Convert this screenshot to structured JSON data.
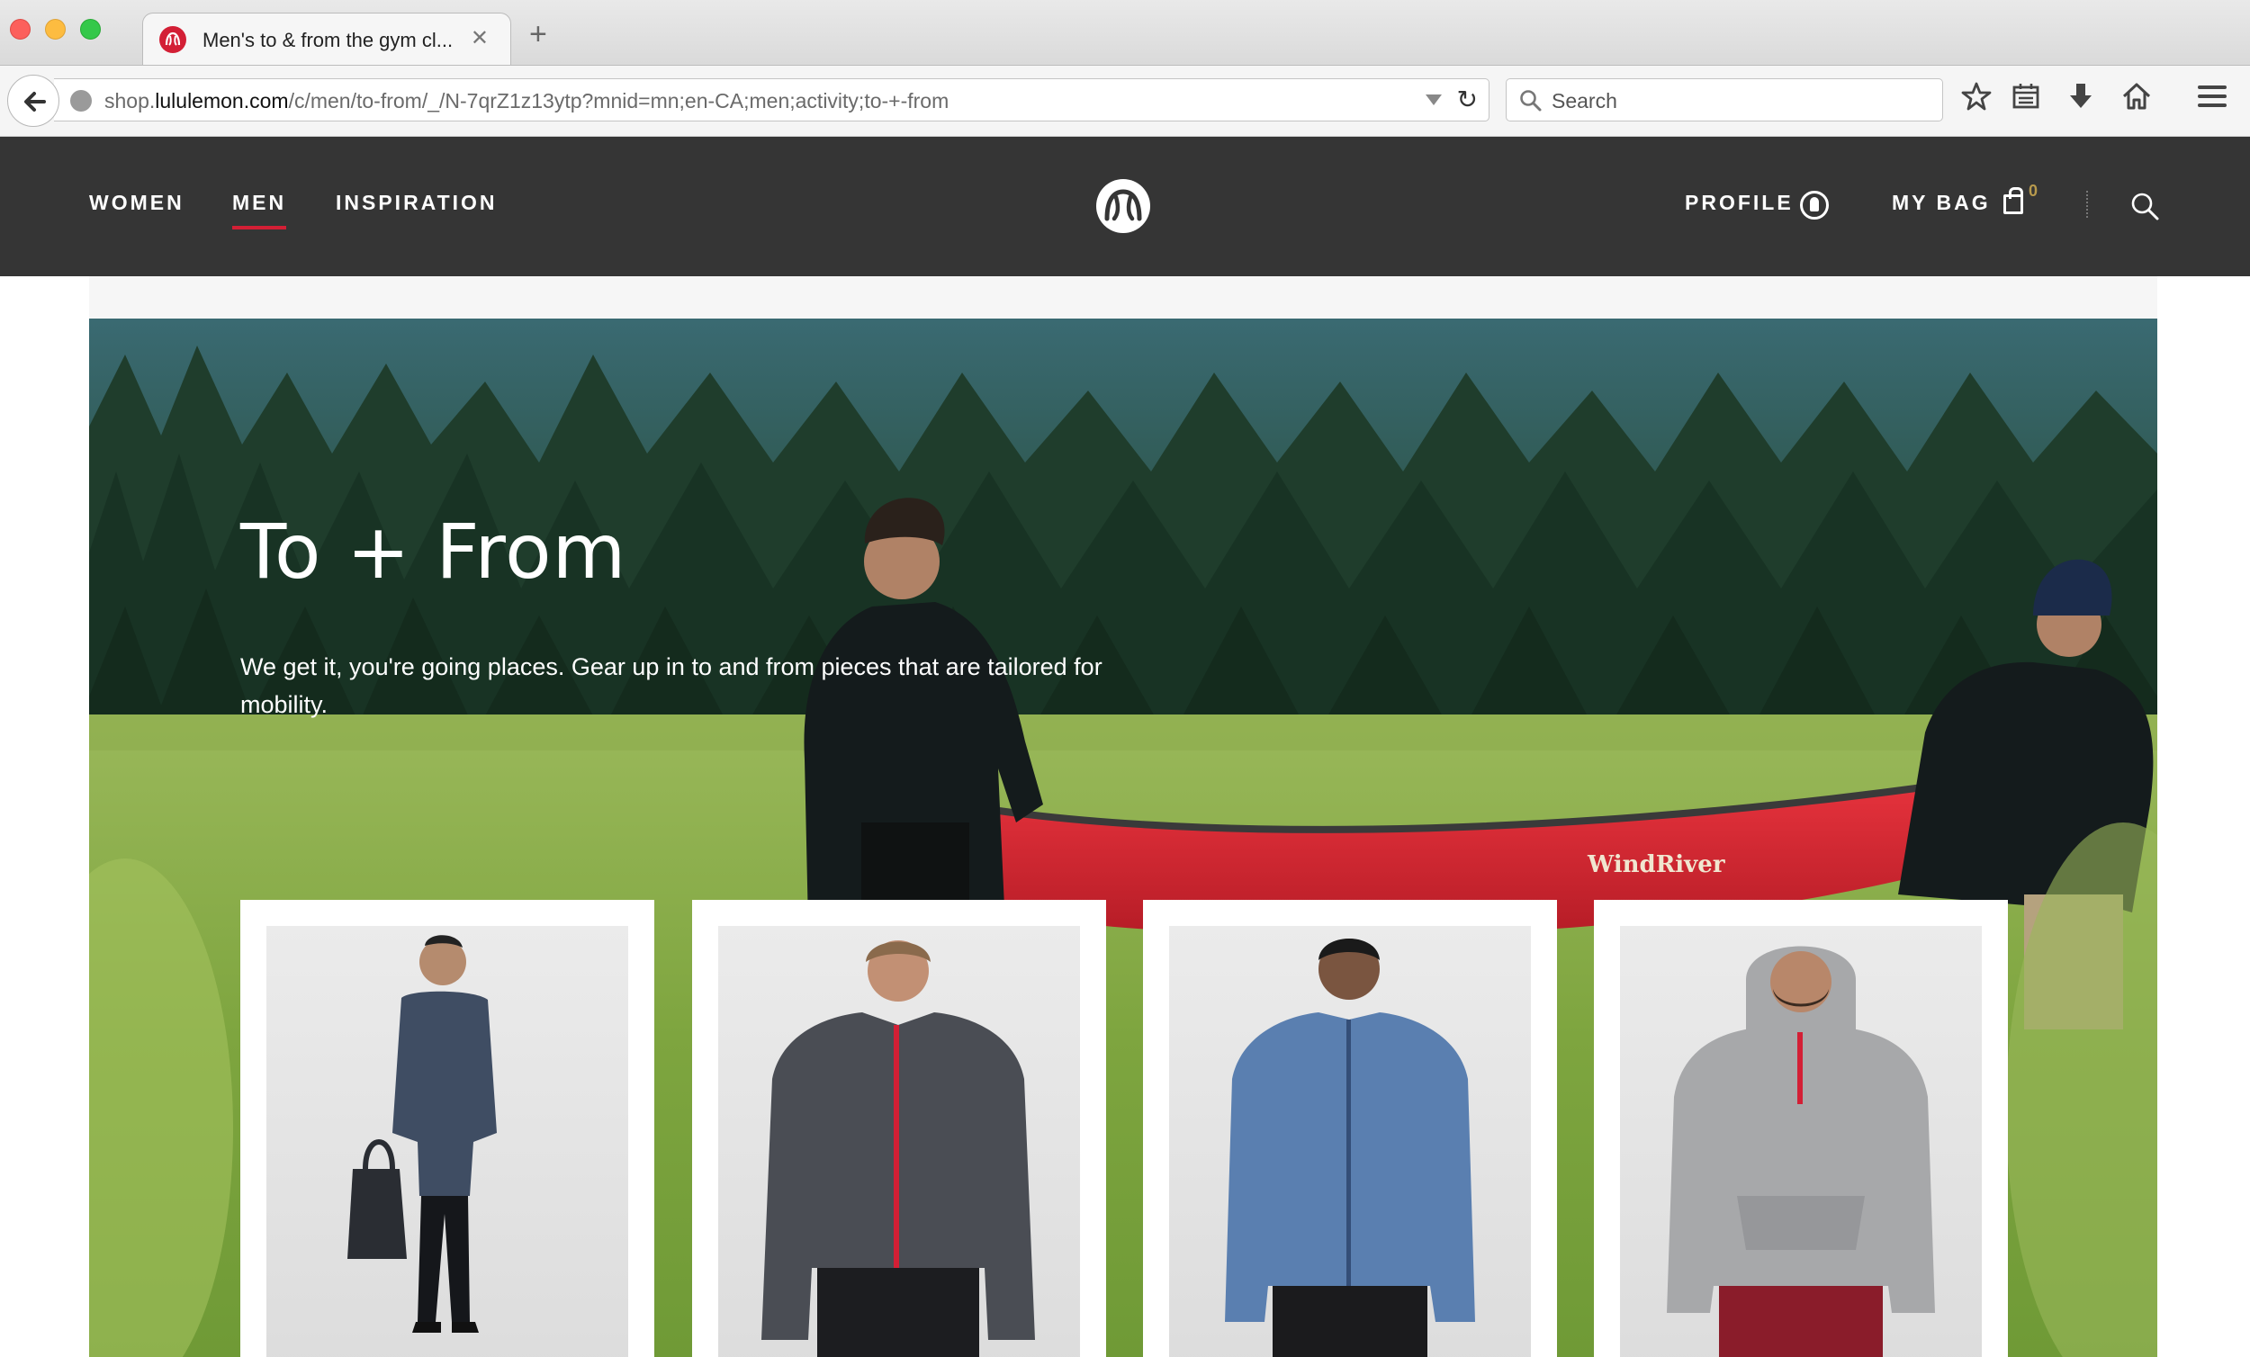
{
  "browser": {
    "tab_title": "Men's to & from the gym cl...",
    "url_host_prefix": "shop.",
    "url_host": "lululemon.com",
    "url_path": "/c/men/to-from/_/N-7qrZ1z13ytp?mnid=mn;en-CA;men;activity;to-+-from",
    "search_placeholder": "Search"
  },
  "site": {
    "nav": {
      "women": "WOMEN",
      "men": "MEN",
      "inspiration": "INSPIRATION"
    },
    "profile_label": "PROFILE",
    "bag_label": "MY BAG",
    "bag_count": "0",
    "accent_color": "#d31f35"
  },
  "hero": {
    "title": "To + From",
    "subtitle": "We get it, you're going places. Gear up in to and from pieces that are tailored for mobility.",
    "canoe_text": "WindRiver"
  },
  "products": [
    {
      "name": "product-bomber-jacket",
      "jacket_color": "#3f4d63"
    },
    {
      "name": "product-grey-zip-jacket",
      "jacket_color": "#4a4d54"
    },
    {
      "name": "product-blue-track-jacket",
      "jacket_color": "#5a7fb0"
    },
    {
      "name": "product-grey-hoodie",
      "jacket_color": "#a7a8aa"
    }
  ]
}
